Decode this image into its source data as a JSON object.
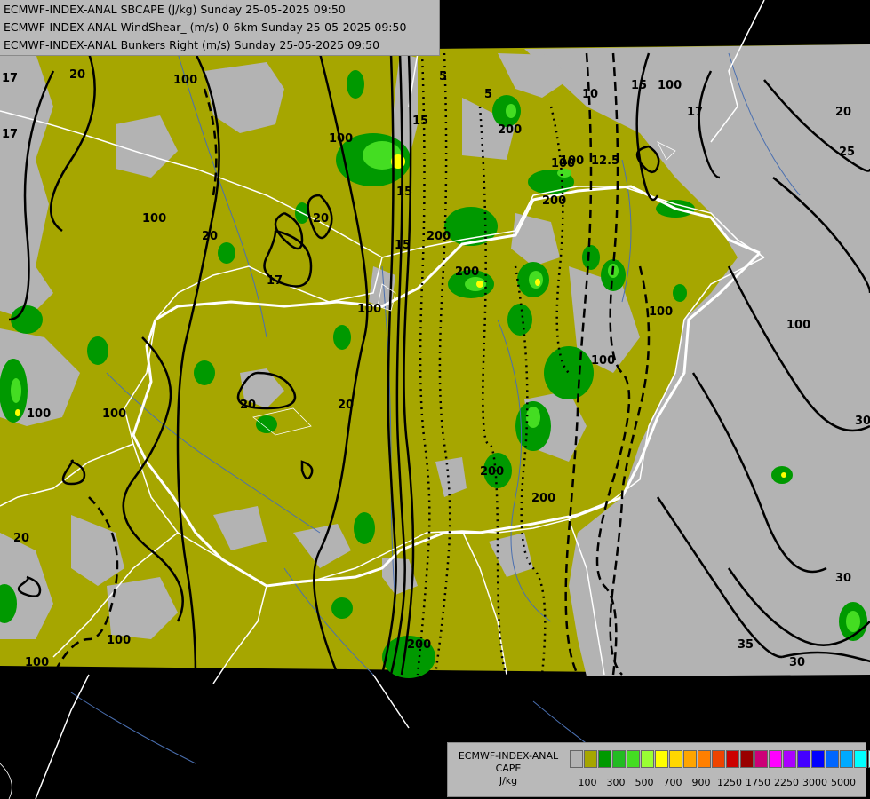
{
  "header": {
    "line1": "ECMWF-INDEX-ANAL SBCAPE (J/kg) Sunday 25-05-2025 09:50",
    "line2": "ECMWF-INDEX-ANAL WindShear_ (m/s) 0-6km Sunday 25-05-2025 09:50",
    "line3": "ECMWF-INDEX-ANAL Bunkers Right (m/s) Sunday 25-05-2025 09:50"
  },
  "legend": {
    "title_line1": "ECMWF-INDEX-ANAL",
    "title_line2": "CAPE",
    "title_line3": "J/kg",
    "colors": [
      "#b3b3b3",
      "#a6a600",
      "#009900",
      "#22bb22",
      "#44dd22",
      "#99ff33",
      "#ffff00",
      "#ffd700",
      "#ffa500",
      "#ff7f00",
      "#ee4400",
      "#cc0000",
      "#990000",
      "#cc0077",
      "#ff00ff",
      "#aa00ff",
      "#4400ff",
      "#0000ff",
      "#0066ff",
      "#00aaff",
      "#00ffff",
      "#aaffff",
      "#ffffff"
    ],
    "tick_labels": [
      "100",
      "300",
      "500",
      "700",
      "900",
      "1250",
      "1750",
      "2250",
      "3000",
      "5000"
    ]
  },
  "map": {
    "colors": {
      "background": "#000000",
      "cape_100_plus": "#a6a600",
      "cape_below_100": "#b3b3b3",
      "cape_300_plus": "#009900",
      "cape_500_plus": "#22bb22",
      "cape_700_plus": "#44dd22",
      "cape_900_plus": "#ffff00",
      "borders": "#ffffff",
      "rivers": "#4a6fb0",
      "contours": "#000000"
    },
    "contour_labels": [
      "17",
      "20",
      "100",
      "100",
      "17",
      "20",
      "25",
      "30",
      "35",
      "30",
      "20",
      "20",
      "20",
      "100",
      "100",
      "20",
      "100",
      "20",
      "100",
      "17",
      "100",
      "200",
      "200",
      "200",
      "200",
      "100",
      "200",
      "10",
      "15",
      "12.5",
      "100",
      "15",
      "5",
      "15",
      "200",
      "5",
      "200",
      "100",
      "100",
      "17",
      "100",
      "100",
      "30",
      "100",
      "15"
    ]
  }
}
